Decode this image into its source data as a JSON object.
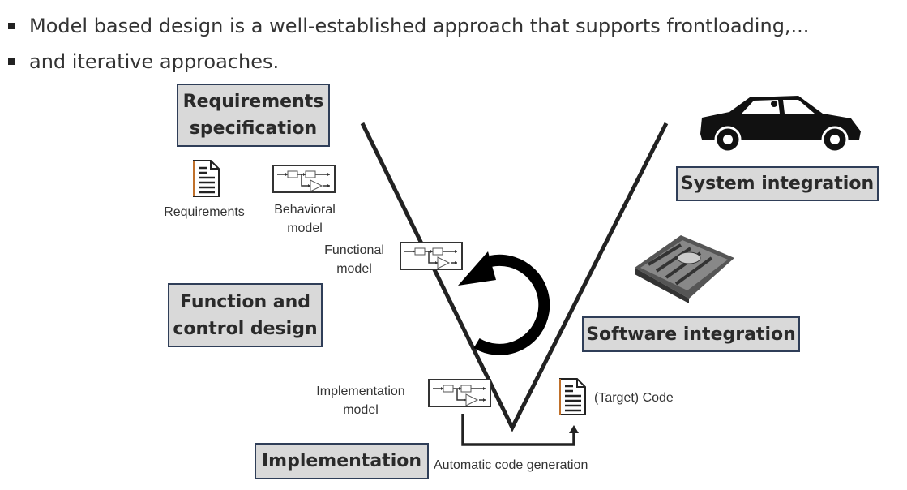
{
  "bullets": [
    "Model based design is a well-established approach that supports frontloading,...",
    "and iterative approaches."
  ],
  "stages": {
    "requirements": "Requirements specification",
    "function": "Function and control design",
    "implementation": "Implementation",
    "system": "System integration",
    "software": "Software integration"
  },
  "labels": {
    "requirements": "Requirements",
    "behavioral": "Behavioral model",
    "functional": "Functional model",
    "implementation_model": "Implementation model",
    "target_code": "(Target) Code",
    "code_gen": "Automatic code generation"
  },
  "icons": [
    "document-icon",
    "block-diagram-icon",
    "car-icon",
    "ecu-icon",
    "cycle-arrow-icon"
  ],
  "colors": {
    "box_fill": "#d9d9d9",
    "box_border": "#2f3e58",
    "doc_accent": "#c0702a"
  }
}
